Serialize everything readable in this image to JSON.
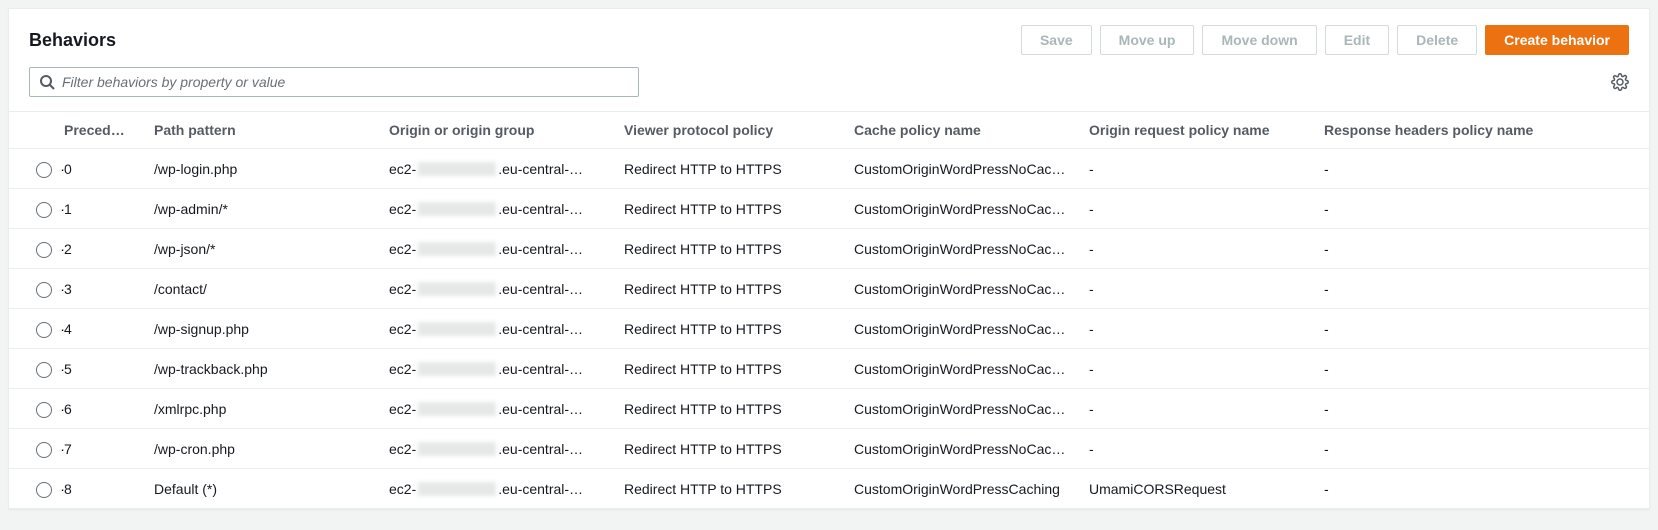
{
  "header": {
    "title": "Behaviors",
    "buttons": {
      "save": "Save",
      "moveUp": "Move up",
      "moveDown": "Move down",
      "edit": "Edit",
      "delete": "Delete",
      "create": "Create behavior"
    }
  },
  "filter": {
    "placeholder": "Filter behaviors by property or value"
  },
  "columns": {
    "precedence": "Preced…",
    "pathPattern": "Path pattern",
    "origin": "Origin or origin group",
    "viewerPolicy": "Viewer protocol policy",
    "cachePolicy": "Cache policy name",
    "originRequestPolicy": "Origin request policy name",
    "responseHeadersPolicy": "Response headers policy name"
  },
  "originParts": {
    "prefix": "ec2-",
    "suffix": ".eu-central-…"
  },
  "rows": [
    {
      "precedence": "0",
      "path": "/wp-login.php",
      "viewer": "Redirect HTTP to HTTPS",
      "cache": "CustomOriginWordPressNoCaching",
      "oreq": "-",
      "resp": "-"
    },
    {
      "precedence": "1",
      "path": "/wp-admin/*",
      "viewer": "Redirect HTTP to HTTPS",
      "cache": "CustomOriginWordPressNoCaching",
      "oreq": "-",
      "resp": "-"
    },
    {
      "precedence": "2",
      "path": "/wp-json/*",
      "viewer": "Redirect HTTP to HTTPS",
      "cache": "CustomOriginWordPressNoCaching",
      "oreq": "-",
      "resp": "-"
    },
    {
      "precedence": "3",
      "path": "/contact/",
      "viewer": "Redirect HTTP to HTTPS",
      "cache": "CustomOriginWordPressNoCaching",
      "oreq": "-",
      "resp": "-"
    },
    {
      "precedence": "4",
      "path": "/wp-signup.php",
      "viewer": "Redirect HTTP to HTTPS",
      "cache": "CustomOriginWordPressNoCaching",
      "oreq": "-",
      "resp": "-"
    },
    {
      "precedence": "5",
      "path": "/wp-trackback.php",
      "viewer": "Redirect HTTP to HTTPS",
      "cache": "CustomOriginWordPressNoCaching",
      "oreq": "-",
      "resp": "-"
    },
    {
      "precedence": "6",
      "path": "/xmlrpc.php",
      "viewer": "Redirect HTTP to HTTPS",
      "cache": "CustomOriginWordPressNoCaching",
      "oreq": "-",
      "resp": "-"
    },
    {
      "precedence": "7",
      "path": "/wp-cron.php",
      "viewer": "Redirect HTTP to HTTPS",
      "cache": "CustomOriginWordPressNoCaching",
      "oreq": "-",
      "resp": "-"
    },
    {
      "precedence": "8",
      "path": "Default (*)",
      "viewer": "Redirect HTTP to HTTPS",
      "cache": "CustomOriginWordPressCaching",
      "oreq": "UmamiCORSRequest",
      "resp": "-"
    }
  ]
}
